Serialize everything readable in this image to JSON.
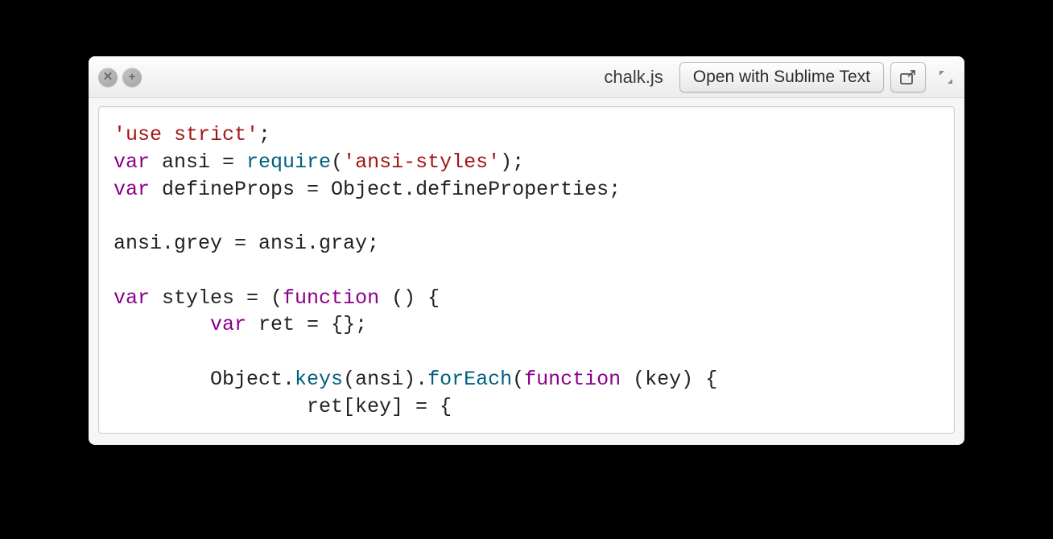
{
  "titlebar": {
    "doc_title": "chalk.js",
    "open_button_label": "Open with Sublime Text",
    "close_glyph": "✕",
    "add_glyph": "+"
  },
  "code": {
    "tokens": [
      {
        "t": "'use strict'",
        "c": "s-str"
      },
      {
        "t": ";\n",
        "c": "s-pn"
      },
      {
        "t": "var",
        "c": "s-kw"
      },
      {
        "t": " ansi = ",
        "c": "s-id"
      },
      {
        "t": "require",
        "c": "s-fn"
      },
      {
        "t": "(",
        "c": "s-pn"
      },
      {
        "t": "'ansi-styles'",
        "c": "s-str"
      },
      {
        "t": ");\n",
        "c": "s-pn"
      },
      {
        "t": "var",
        "c": "s-kw"
      },
      {
        "t": " defineProps = Object.defineProperties;\n",
        "c": "s-id"
      },
      {
        "t": "\n",
        "c": "s-pn"
      },
      {
        "t": "ansi.grey = ansi.gray;\n",
        "c": "s-id"
      },
      {
        "t": "\n",
        "c": "s-pn"
      },
      {
        "t": "var",
        "c": "s-kw"
      },
      {
        "t": " styles = (",
        "c": "s-id"
      },
      {
        "t": "function",
        "c": "s-kw"
      },
      {
        "t": " () {\n",
        "c": "s-pn"
      },
      {
        "t": "        ",
        "c": "s-pn"
      },
      {
        "t": "var",
        "c": "s-kw"
      },
      {
        "t": " ret = {};\n",
        "c": "s-id"
      },
      {
        "t": "\n",
        "c": "s-pn"
      },
      {
        "t": "        Object.",
        "c": "s-id"
      },
      {
        "t": "keys",
        "c": "s-fn"
      },
      {
        "t": "(ansi).",
        "c": "s-id"
      },
      {
        "t": "forEach",
        "c": "s-fn"
      },
      {
        "t": "(",
        "c": "s-pn"
      },
      {
        "t": "function",
        "c": "s-kw"
      },
      {
        "t": " (key) {\n",
        "c": "s-pn"
      },
      {
        "t": "                ret[key] = {",
        "c": "s-id"
      }
    ]
  }
}
